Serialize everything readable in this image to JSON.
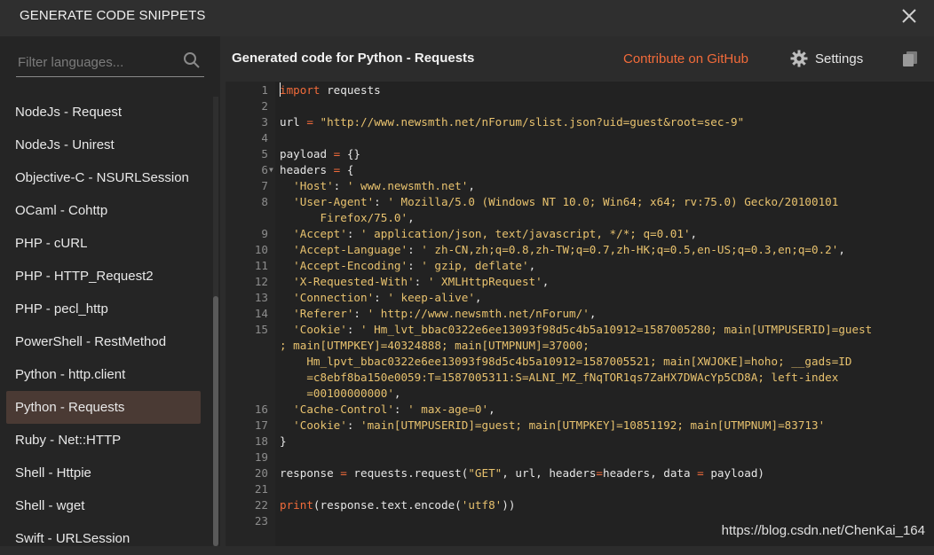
{
  "dialog": {
    "title": "GENERATE CODE SNIPPETS"
  },
  "filter": {
    "placeholder": "Filter languages..."
  },
  "languages": [
    "NodeJs - Request",
    "NodeJs - Unirest",
    "Objective-C - NSURLSession",
    "OCaml - Cohttp",
    "PHP - cURL",
    "PHP - HTTP_Request2",
    "PHP - pecl_http",
    "PowerShell - RestMethod",
    "Python - http.client",
    "Python - Requests",
    "Ruby - Net::HTTP",
    "Shell - Httpie",
    "Shell - wget",
    "Swift - URLSession"
  ],
  "selected_language": "Python - Requests",
  "header": {
    "generated_title": "Generated code for Python - Requests",
    "contribute_label": "Contribute on GitHub",
    "settings_label": "Settings"
  },
  "code": {
    "lines": [
      {
        "n": "1",
        "html": "<span class=\"kw\">import</span> requests"
      },
      {
        "n": "2",
        "html": ""
      },
      {
        "n": "3",
        "html": "url <span class=\"op\">=</span> <span class=\"str\">\"http://www.newsmth.net/nForum/slist.json?uid=guest&root=sec-9\"</span>"
      },
      {
        "n": "4",
        "html": ""
      },
      {
        "n": "5",
        "html": "payload <span class=\"op\">=</span> {}"
      },
      {
        "n": "6",
        "html": "headers <span class=\"op\">=</span> {",
        "fold": true
      },
      {
        "n": "7",
        "html": "  <span class=\"str\">'Host'</span>: <span class=\"str\">' www.newsmth.net'</span>,"
      },
      {
        "n": "8",
        "html": "  <span class=\"str\">'User-Agent'</span>: <span class=\"str\">' Mozilla/5.0 (Windows NT 10.0; Win64; x64; rv:75.0) Gecko/20100101</span>"
      },
      {
        "n": "",
        "html": "<span class=\"str\">      Firefox/75.0'</span>,"
      },
      {
        "n": "9",
        "html": "  <span class=\"str\">'Accept'</span>: <span class=\"str\">' application/json, text/javascript, */*; q=0.01'</span>,"
      },
      {
        "n": "10",
        "html": "  <span class=\"str\">'Accept-Language'</span>: <span class=\"str\">' zh-CN,zh;q=0.8,zh-TW;q=0.7,zh-HK;q=0.5,en-US;q=0.3,en;q=0.2'</span>,"
      },
      {
        "n": "11",
        "html": "  <span class=\"str\">'Accept-Encoding'</span>: <span class=\"str\">' gzip, deflate'</span>,"
      },
      {
        "n": "12",
        "html": "  <span class=\"str\">'X-Requested-With'</span>: <span class=\"str\">' XMLHttpRequest'</span>,"
      },
      {
        "n": "13",
        "html": "  <span class=\"str\">'Connection'</span>: <span class=\"str\">' keep-alive'</span>,"
      },
      {
        "n": "14",
        "html": "  <span class=\"str\">'Referer'</span>: <span class=\"str\">' http://www.newsmth.net/nForum/'</span>,"
      },
      {
        "n": "15",
        "html": "  <span class=\"str\">'Cookie'</span>: <span class=\"str\">' Hm_lvt_bbac0322e6ee13093f98d5c4b5a10912=1587005280; main[UTMPUSERID]=guest</span>"
      },
      {
        "n": "",
        "html": "<span class=\"str\">; main[UTMPKEY]=40324888; main[UTMPNUM]=37000;</span>"
      },
      {
        "n": "",
        "html": "<span class=\"str\">    Hm_lpvt_bbac0322e6ee13093f98d5c4b5a10912=1587005521; main[XWJOKE]=hoho; __gads=ID</span>"
      },
      {
        "n": "",
        "html": "<span class=\"str\">    =c8ebf8ba150e0059:T=1587005311:S=ALNI_MZ_fNqTOR1qs7ZaHX7DWAcYp5CD8A; left-index</span>"
      },
      {
        "n": "",
        "html": "<span class=\"str\">    =00100000000'</span>,"
      },
      {
        "n": "16",
        "html": "  <span class=\"str\">'Cache-Control'</span>: <span class=\"str\">' max-age=0'</span>,"
      },
      {
        "n": "17",
        "html": "  <span class=\"str\">'Cookie'</span>: <span class=\"str\">'main[UTMPUSERID]=guest; main[UTMPKEY]=10851192; main[UTMPNUM]=83713'</span>"
      },
      {
        "n": "18",
        "html": "}"
      },
      {
        "n": "19",
        "html": ""
      },
      {
        "n": "20",
        "html": "response <span class=\"op\">=</span> requests.request(<span class=\"str\">\"GET\"</span>, url, headers<span class=\"op\">=</span>headers, data <span class=\"op\">=</span> payload)"
      },
      {
        "n": "21",
        "html": ""
      },
      {
        "n": "22",
        "html": "<span class=\"kw\">print</span>(response.text.encode(<span class=\"str\">'utf8'</span>))"
      },
      {
        "n": "23",
        "html": ""
      }
    ]
  },
  "watermark": "https://blog.csdn.net/ChenKai_164",
  "colors": {
    "accent": "#f26b3a",
    "string": "#e8c26e",
    "selected_bg": "#4a3a34"
  },
  "icons": {
    "close": "close-icon",
    "search": "search-icon",
    "settings": "gear-icon",
    "copy": "copy-icon"
  }
}
